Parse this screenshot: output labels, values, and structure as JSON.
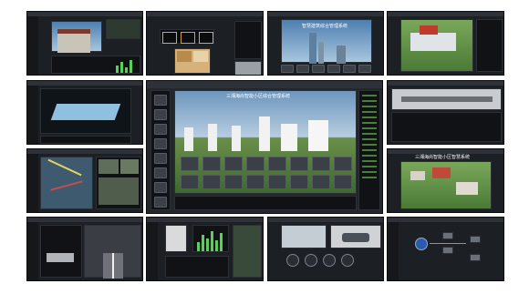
{
  "collage": {
    "tiles": [
      {
        "name": "tile-building-monitor",
        "title": ""
      },
      {
        "name": "tile-floorplan-access",
        "title": ""
      },
      {
        "name": "tile-city-tower",
        "title": "智慧建筑综合管理系统"
      },
      {
        "name": "tile-campus-aerial",
        "title": ""
      },
      {
        "name": "tile-3d-terrain",
        "title": ""
      },
      {
        "name": "tile-main-community",
        "title": "三湘海尚智能小区综合管理系统"
      },
      {
        "name": "tile-pipe-gallery",
        "title": ""
      },
      {
        "name": "tile-gis-video",
        "title": ""
      },
      {
        "name": "tile-town-overview",
        "title": "三湘海尚智能小区智慧系统"
      },
      {
        "name": "tile-tunnel",
        "title": ""
      },
      {
        "name": "tile-energy-dashboard",
        "title": ""
      },
      {
        "name": "tile-parking-system",
        "title": ""
      },
      {
        "name": "tile-device-topology",
        "title": ""
      }
    ]
  },
  "colors": {
    "frame": "#1c1f24",
    "titlebar": "#2e3238",
    "accent_green": "#5ad05a",
    "sky": "#6f9cc6",
    "grass": "#5a8a40"
  },
  "icons": [
    "power-icon",
    "camera-icon",
    "lock-icon",
    "light-icon",
    "alarm-icon",
    "car-icon",
    "chart-icon"
  ]
}
